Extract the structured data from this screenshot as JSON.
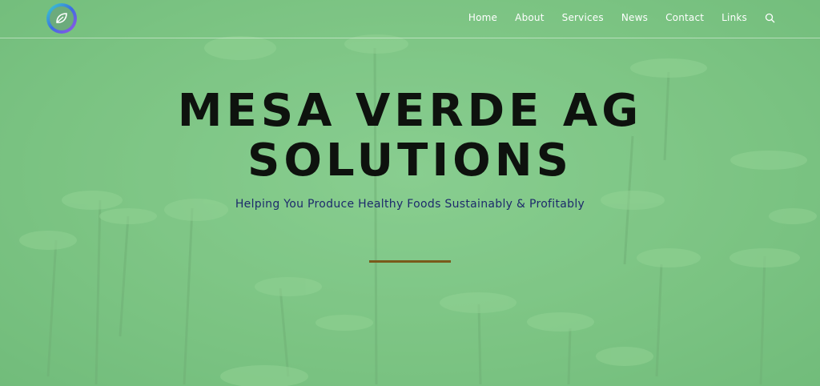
{
  "site": {
    "logo": "leaf-logo"
  },
  "nav": {
    "items": [
      "Home",
      "About",
      "Services",
      "News",
      "Contact",
      "Links"
    ],
    "search_icon": "search-icon"
  },
  "hero": {
    "title_line1": "MESA VERDE AG",
    "title_line2": "SOLUTIONS",
    "subtitle": "Helping You Produce Healthy Foods Sustainably & Profitably"
  },
  "colors": {
    "overlay": "#6fb778",
    "title": "#0e120e",
    "subtitle": "#1d2a6b",
    "divider": "#7a5a1b",
    "nav_text": "#ffffff"
  }
}
